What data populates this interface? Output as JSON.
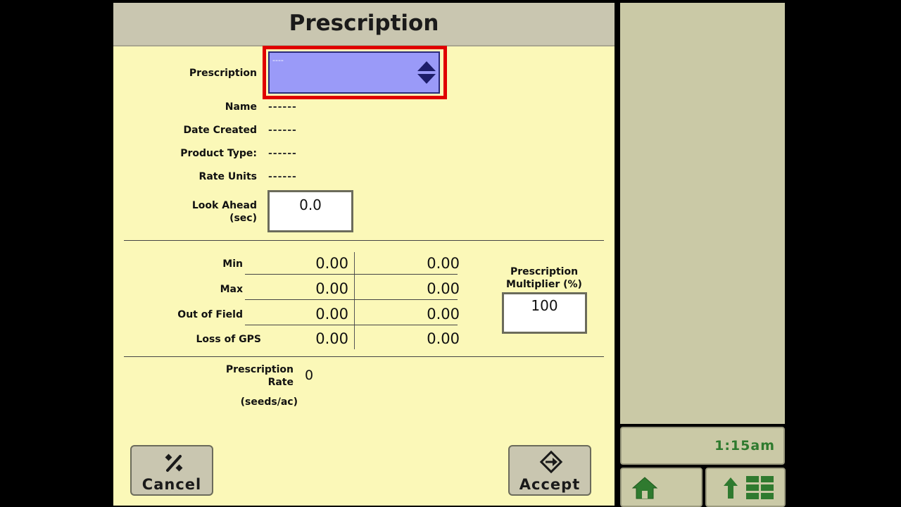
{
  "header": {
    "title": "Prescription"
  },
  "prescription_select": {
    "label": "Prescription",
    "value": "----"
  },
  "info": [
    {
      "label": "Name",
      "value": "------"
    },
    {
      "label": "Date Created",
      "value": "------"
    },
    {
      "label": "Product Type:",
      "value": "------"
    },
    {
      "label": "Rate Units",
      "value": "------"
    }
  ],
  "look_ahead": {
    "label_line1": "Look Ahead",
    "label_line2": "(sec)",
    "value": "0.0"
  },
  "rate_table": {
    "rows": [
      {
        "label": "Min",
        "col1": "0.00",
        "col2": "0.00"
      },
      {
        "label": "Max",
        "col1": "0.00",
        "col2": "0.00"
      },
      {
        "label": "Out of Field",
        "col1": "0.00",
        "col2": "0.00"
      },
      {
        "label": "Loss of GPS",
        "col1": "0.00",
        "col2": "0.00"
      }
    ]
  },
  "multiplier": {
    "label_line1": "Prescription",
    "label_line2": "Multiplier (%)",
    "value": "100"
  },
  "prescription_rate": {
    "label_line1": "Prescription",
    "label_line2": "Rate",
    "value": "0",
    "units": "(seeds/ac)"
  },
  "buttons": {
    "cancel": "Cancel",
    "accept": "Accept"
  },
  "side": {
    "clock": "1:15am",
    "home_icon": "home-icon",
    "menu_icon": "menu-grid-icon"
  },
  "colors": {
    "background": "#fbf8b8",
    "header": "#c9c6b0",
    "select_fill": "#9a9af8",
    "highlight": "#e00000",
    "clock_text": "#2e7a2e"
  }
}
